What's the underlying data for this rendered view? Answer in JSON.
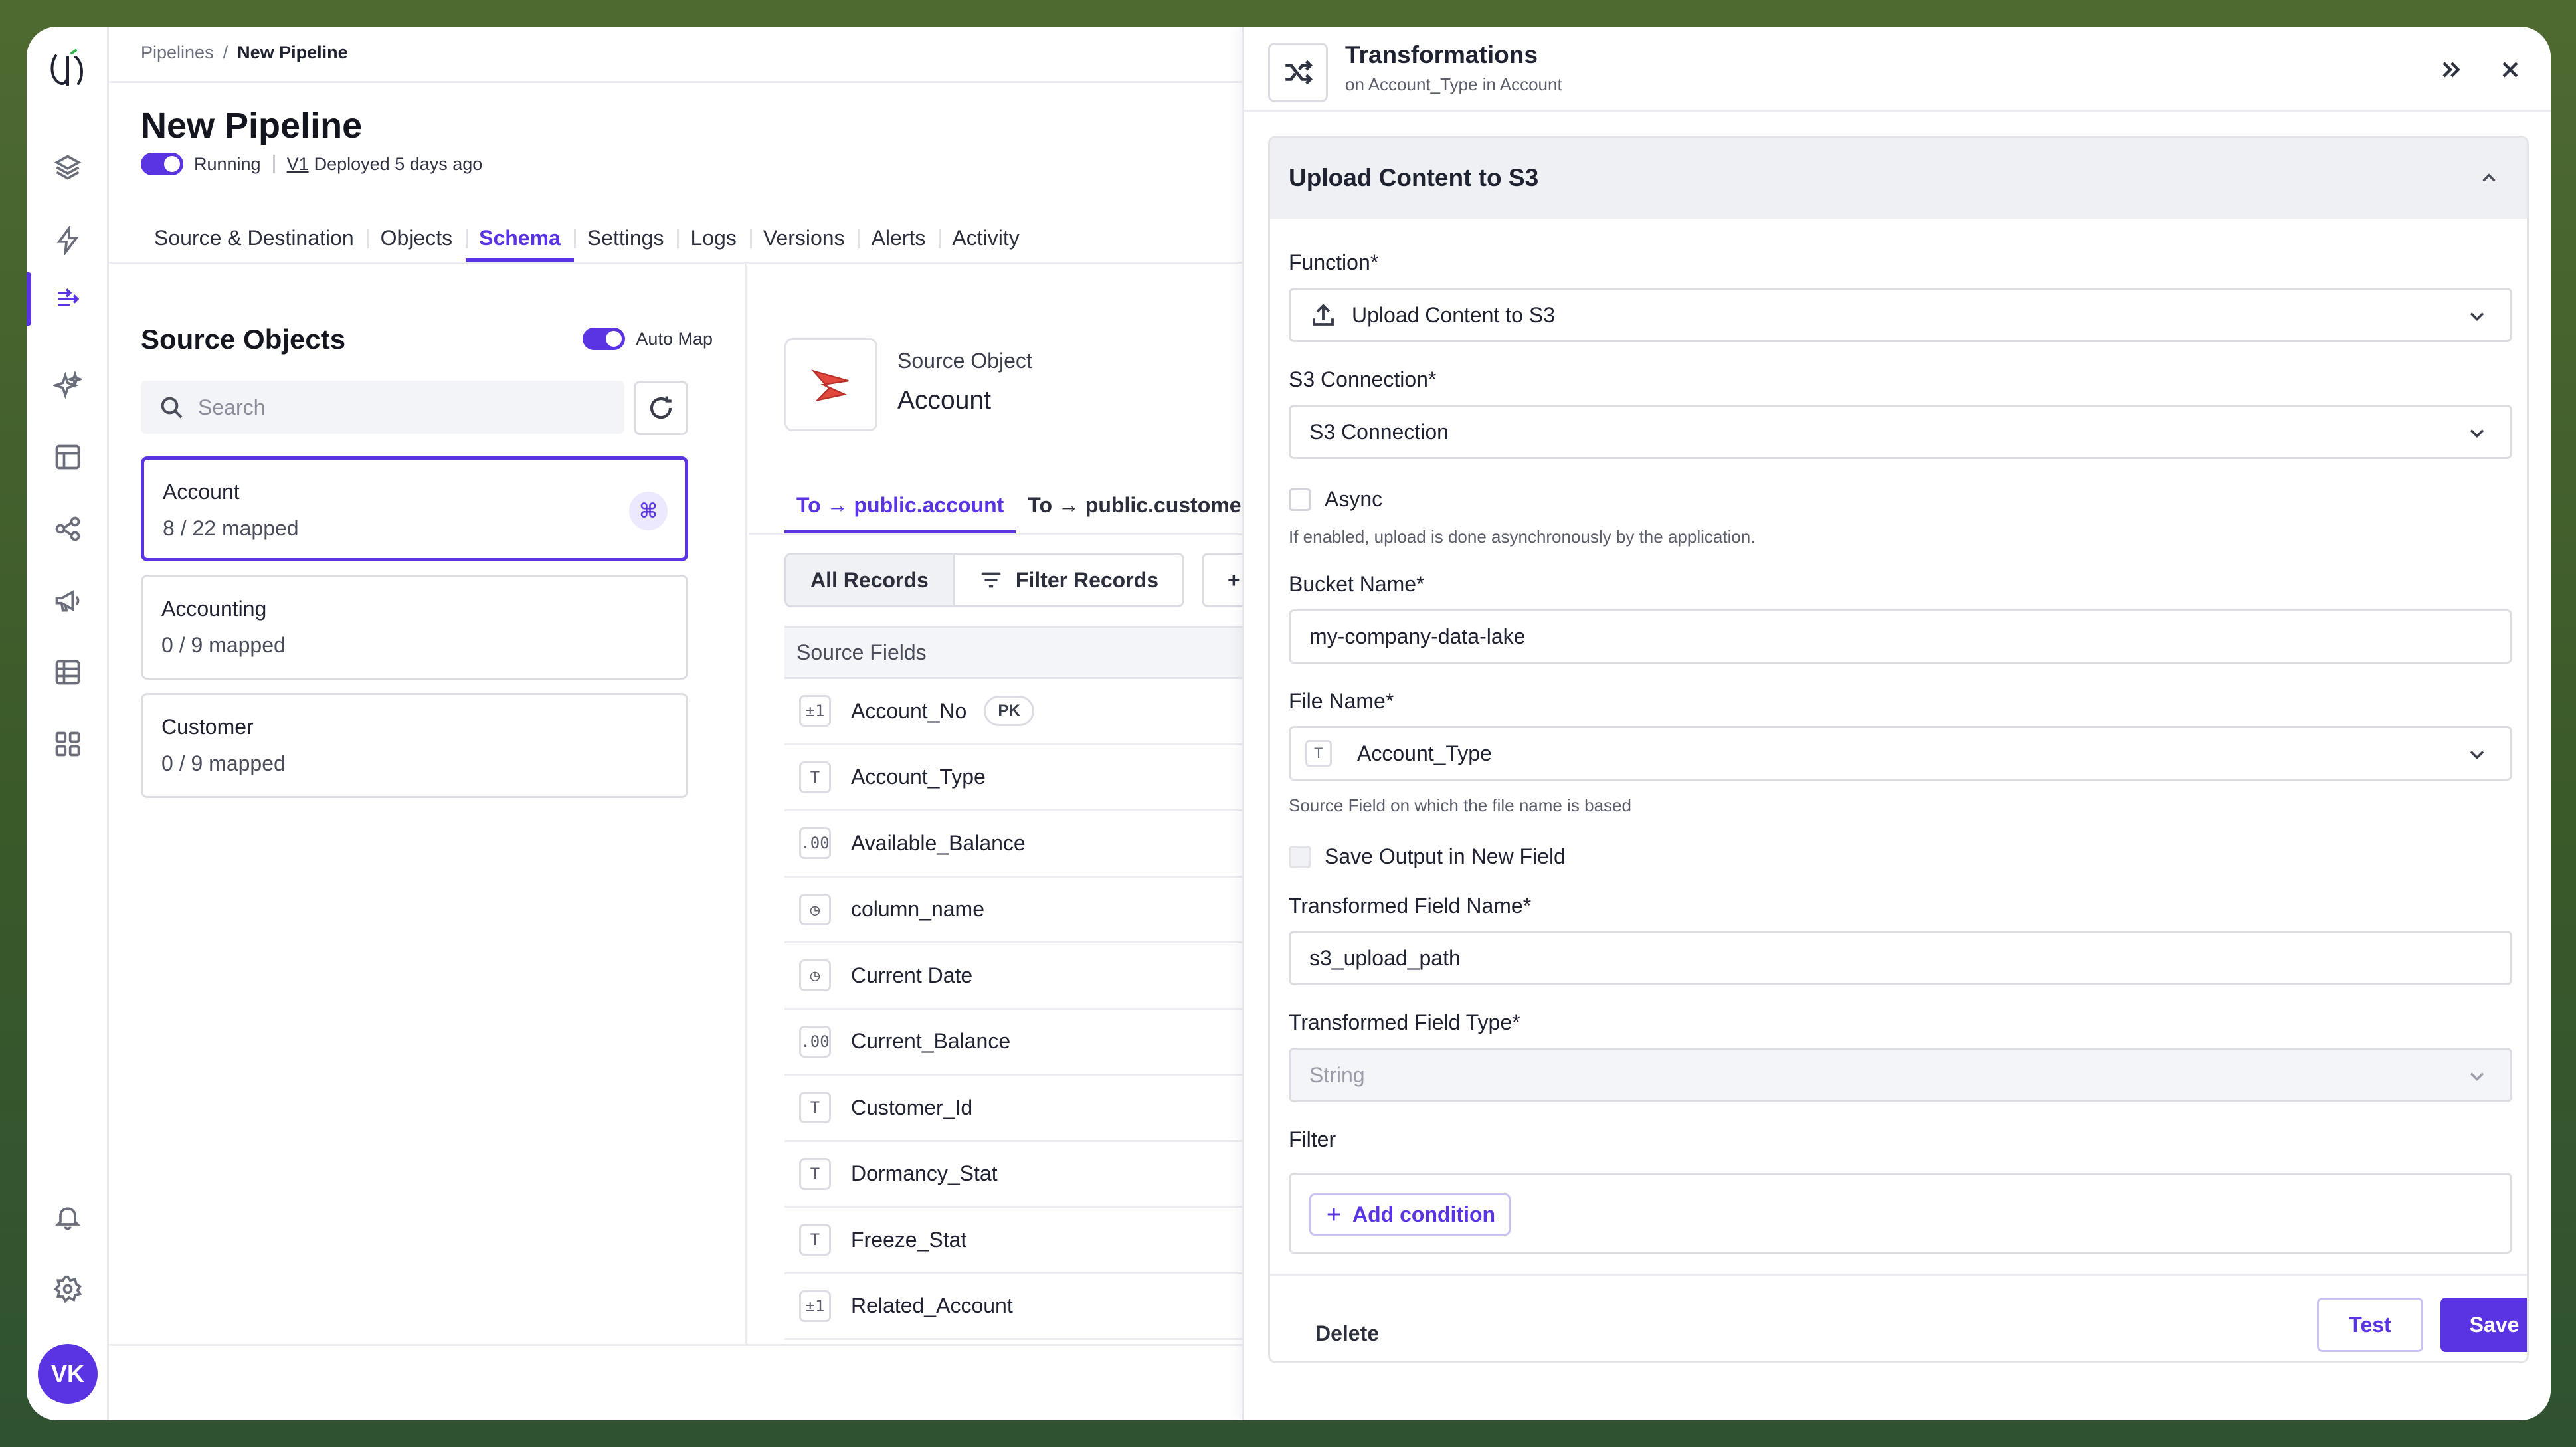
{
  "colors": {
    "accent": "#5a34e2",
    "border": "#dcdde4",
    "text": "#1f2230"
  },
  "user": {
    "initials": "VK"
  },
  "rail": {
    "items": [
      "layers-icon",
      "lightning-icon",
      "pipeline-icon",
      "sparkles-icon",
      "layout-icon",
      "share-nodes-icon",
      "megaphone-icon",
      "table-icon",
      "grid-icon",
      "bell-icon",
      "gear-icon"
    ]
  },
  "breadcrumb": {
    "parent": "Pipelines",
    "separator": "/",
    "current": "New Pipeline"
  },
  "pipeline": {
    "title": "New Pipeline",
    "status": "Running",
    "version": "V1",
    "deployed": "Deployed 5 days ago"
  },
  "tabs": [
    {
      "label": "Source & Destination"
    },
    {
      "label": "Objects"
    },
    {
      "label": "Schema"
    },
    {
      "label": "Settings"
    },
    {
      "label": "Logs"
    },
    {
      "label": "Versions"
    },
    {
      "label": "Alerts"
    },
    {
      "label": "Activity"
    }
  ],
  "source_objects": {
    "title": "Source Objects",
    "automap_label": "Auto Map",
    "search_placeholder": "Search",
    "items": [
      {
        "name": "Account",
        "mapped": "8 / 22 mapped"
      },
      {
        "name": "Accounting",
        "mapped": "0 / 9 mapped"
      },
      {
        "name": "Customer",
        "mapped": "0 / 9 mapped"
      }
    ]
  },
  "mapping": {
    "source_object_label": "Source Object",
    "source_object_value": "Account",
    "subtabs": [
      {
        "label": "To → public.account"
      },
      {
        "label": "To → public.customer"
      }
    ],
    "segments": {
      "all": "All Records",
      "filter": "Filter Records",
      "add": "+ Tr"
    },
    "fields_header": "Source Fields",
    "pk_label": "PK",
    "fields": [
      {
        "type": "±1",
        "name": "Account_No"
      },
      {
        "type": "T",
        "name": "Account_Type"
      },
      {
        "type": ".00",
        "name": "Available_Balance"
      },
      {
        "type": "◷",
        "name": "column_name"
      },
      {
        "type": "◷",
        "name": "Current Date"
      },
      {
        "type": ".00",
        "name": "Current_Balance"
      },
      {
        "type": "T",
        "name": "Customer_Id"
      },
      {
        "type": "T",
        "name": "Dormancy_Stat"
      },
      {
        "type": "T",
        "name": "Freeze_Stat"
      },
      {
        "type": "±1",
        "name": "Related_Account"
      }
    ]
  },
  "panel": {
    "title": "Transformations",
    "subtitle": "on Account_Type in Account",
    "section_title": "Upload Content to S3",
    "function_label": "Function*",
    "function_value": "Upload Content to S3",
    "s3_label": "S3 Connection*",
    "s3_value": "S3 Connection",
    "async_label": "Async",
    "async_hint": "If enabled, upload is done asynchronously by the application.",
    "bucket_label": "Bucket Name*",
    "bucket_value": "my-company-data-lake",
    "file_label": "File Name*",
    "file_type": "T",
    "file_value": "Account_Type",
    "file_hint": "Source Field on which the file name is based",
    "save_output_label": "Save Output in New Field",
    "tf_name_label": "Transformed Field Name*",
    "tf_name_value": "s3_upload_path",
    "tf_type_label": "Transformed Field Type*",
    "tf_type_value": "String",
    "filter_label": "Filter",
    "add_condition": "Add condition",
    "delete": "Delete",
    "test": "Test",
    "save": "Save"
  }
}
